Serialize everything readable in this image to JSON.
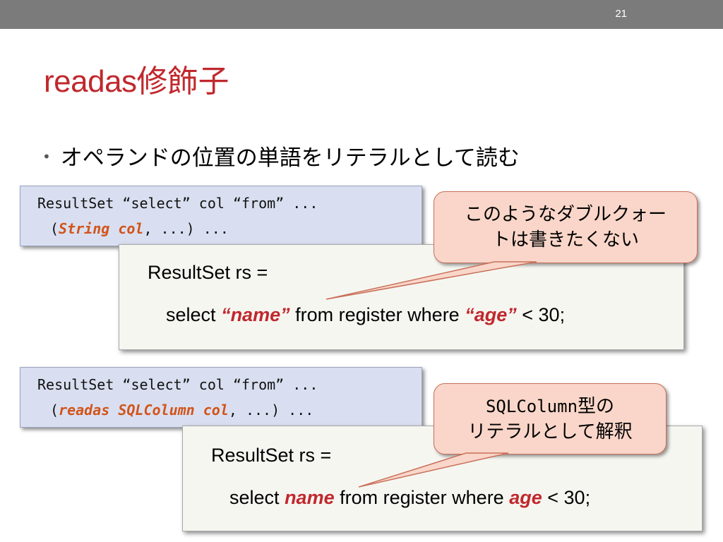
{
  "header": {
    "page_number": "21"
  },
  "title": {
    "prefix": "readas",
    "suffix": "修飾子"
  },
  "bullet": {
    "text": "オペランドの位置の単語をリテラルとして読む"
  },
  "example1": {
    "code": {
      "line1": "ResultSet “select” col “from” ...",
      "line2_open": "(",
      "line2_param": "String col",
      "line2_rest": ", ...) ..."
    },
    "sql": {
      "line1": "ResultSet rs =",
      "select_kw": "select",
      "col": "“name”",
      "middle": "from register where",
      "cond": "“age”",
      "tail": "< 30;"
    },
    "callout": {
      "line1": "このようなダブルクォー",
      "line2": "トは書きたくない"
    }
  },
  "example2": {
    "code": {
      "line1": "ResultSet “select” col “from” ...",
      "line2_open": "(",
      "line2_param": "readas SQLColumn col",
      "line2_rest": ", ...) ..."
    },
    "sql": {
      "line1": "ResultSet rs =",
      "select_kw": "select",
      "col": "name",
      "middle": "from register where",
      "cond": "age",
      "tail": "< 30;"
    },
    "callout": {
      "line1_mono": "SQLColumn",
      "line1_rest": "型の",
      "line2": "リテラルとして解釈"
    }
  },
  "colors": {
    "accent_red": "#c0282d",
    "code_bg": "#d9dff0",
    "callout_bg": "#f9d6c9",
    "keyword_orange": "#d2541a",
    "topbar": "#7b7b7b"
  }
}
